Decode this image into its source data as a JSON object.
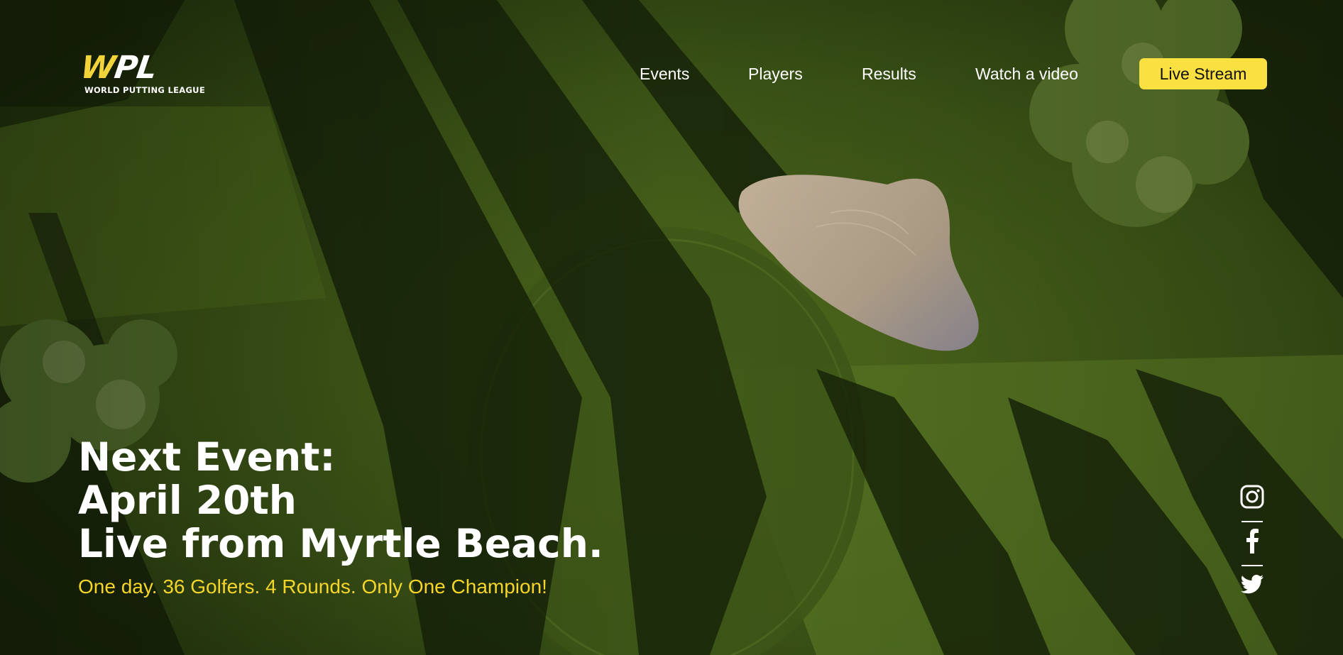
{
  "brand": {
    "logo_text": "WPL",
    "logo_subtitle": "WORLD PUTTING LEAGUE",
    "accent_color": "#fae041"
  },
  "nav": {
    "items": [
      {
        "label": "Events"
      },
      {
        "label": "Players"
      },
      {
        "label": "Results"
      },
      {
        "label": "Watch a video"
      }
    ],
    "cta_label": "Live Stream"
  },
  "hero": {
    "headline_lines": [
      "Next Event:",
      "April 20th",
      "Live from Myrtle Beach."
    ],
    "tagline": "One day. 36 Golfers. 4 Rounds. Only One Champion!",
    "tagline_color": "#f5d52a",
    "background": "aerial photo of golf course green with sand bunker and tree shadows"
  },
  "social": {
    "icons": [
      "instagram-icon",
      "facebook-icon",
      "twitter-icon"
    ]
  }
}
